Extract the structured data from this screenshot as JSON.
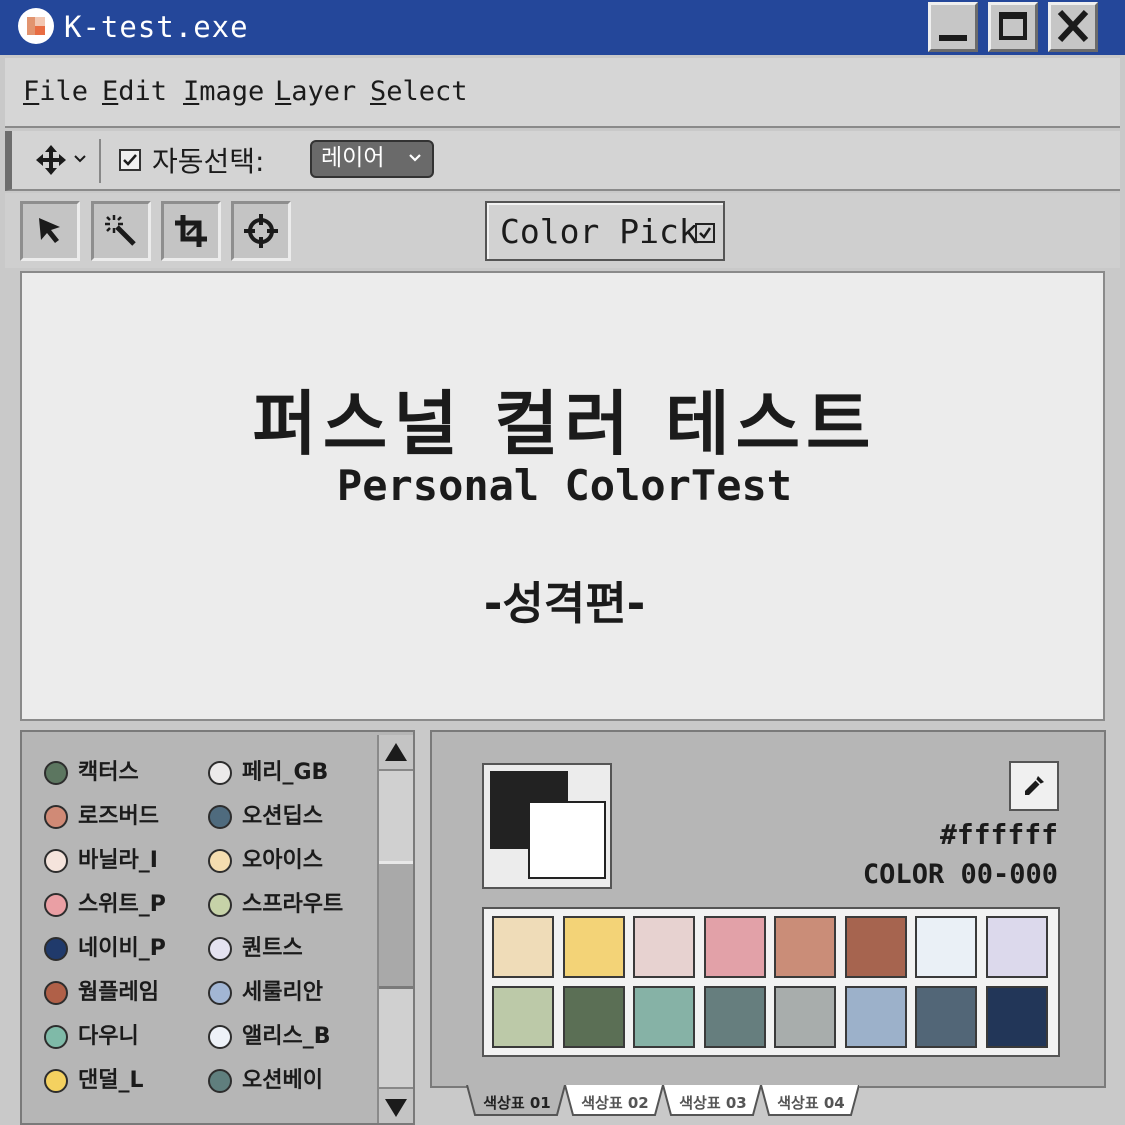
{
  "window": {
    "title": "K-test.exe"
  },
  "menu": {
    "items": [
      {
        "first": "F",
        "rest": "ile"
      },
      {
        "first": "E",
        "rest": "dit"
      },
      {
        "first": "I",
        "rest": "mage"
      },
      {
        "first": "L",
        "rest": "ayer"
      },
      {
        "first": "S",
        "rest": "elect"
      }
    ]
  },
  "options": {
    "auto_select_label": "자동선택:",
    "auto_select_checked": true,
    "layer_select_value": "레이어"
  },
  "toolbar": {
    "color_pick_label": "Color Pick",
    "color_pick_checked": true,
    "tools": [
      "pointer-icon",
      "magic-wand-icon",
      "crop-icon",
      "crosshair-icon"
    ]
  },
  "canvas": {
    "title": "퍼스널 컬러 테스트",
    "subtitle": "Personal ColorTest",
    "section": "-성격편-"
  },
  "swatch_list": {
    "left": [
      {
        "name": "캑터스",
        "color": "#5c7660"
      },
      {
        "name": "로즈버드",
        "color": "#d08a76"
      },
      {
        "name": "바닐라_I",
        "color": "#f5e4dc"
      },
      {
        "name": "스위트_P",
        "color": "#ea9fa4"
      },
      {
        "name": "네이비_P",
        "color": "#203a6b"
      },
      {
        "name": "웜플레임",
        "color": "#b06048"
      },
      {
        "name": "다우니",
        "color": "#7fbaa8"
      },
      {
        "name": "댄덜_L",
        "color": "#f4d160"
      }
    ],
    "right": [
      {
        "name": "페리_GB",
        "color": "#eceaea"
      },
      {
        "name": "오션딥스",
        "color": "#4f6b7e"
      },
      {
        "name": "오아이스",
        "color": "#f4ddb0"
      },
      {
        "name": "스프라우트",
        "color": "#c6d2a8"
      },
      {
        "name": "퀀트스",
        "color": "#e4e2f0"
      },
      {
        "name": "세룰리안",
        "color": "#a2b6d4"
      },
      {
        "name": "앨리스_B",
        "color": "#eef2f8"
      },
      {
        "name": "오션베이",
        "color": "#607f7e"
      }
    ]
  },
  "color_panel": {
    "foreground": "#222222",
    "background": "#ffffff",
    "hex": "#ffffff",
    "code": "COLOR 00-000",
    "palette": [
      "#efdcb8",
      "#f3d377",
      "#e7d2d0",
      "#e2a1a8",
      "#ca8d78",
      "#a6644f",
      "#eaf0f6",
      "#dcd9ec",
      "#bcc9a8",
      "#5b6f55",
      "#86b2a6",
      "#667e7e",
      "#a8adac",
      "#9cb1ca",
      "#526677",
      "#223658"
    ]
  },
  "tabs": [
    {
      "label": "색상표 01",
      "active": true
    },
    {
      "label": "색상표 02",
      "active": false
    },
    {
      "label": "색상표 03",
      "active": false
    },
    {
      "label": "색상표 04",
      "active": false
    }
  ]
}
